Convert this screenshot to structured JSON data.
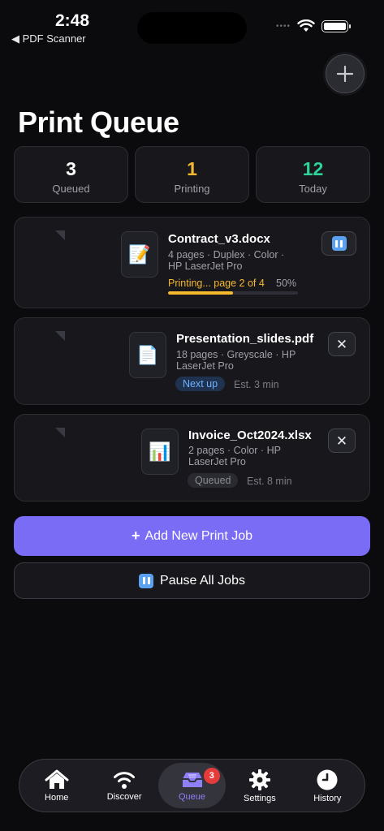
{
  "status_bar": {
    "time": "2:48",
    "back_label": "◀ PDF Scanner"
  },
  "header": {
    "title": "Print Queue"
  },
  "stats": [
    {
      "value": "3",
      "label": "Queued",
      "color": "#ffffff"
    },
    {
      "value": "1",
      "label": "Printing",
      "color": "#f5b92e"
    },
    {
      "value": "12",
      "label": "Today",
      "color": "#2ed39a"
    }
  ],
  "jobs": [
    {
      "name": "Contract_v3.docx",
      "meta_line1": "4 pages · Duplex · Color ·",
      "meta_line2": "HP LaserJet Pro",
      "icon": "📝",
      "status_text": "Printing... page 2 of 4",
      "progress_label": "50%",
      "progress": 0.5,
      "action": "pause"
    },
    {
      "name": "Presentation_slides.pdf",
      "meta_line1": "18 pages · Greyscale · HP",
      "meta_line2": "LaserJet Pro",
      "icon": "📄",
      "badge": "Next up",
      "estimate": "Est. 3 min",
      "action": "remove"
    },
    {
      "name": "Invoice_Oct2024.xlsx",
      "meta_line1": "2 pages · Color · HP",
      "meta_line2": "LaserJet Pro",
      "icon": "📊",
      "badge": "Queued",
      "estimate": "Est. 8 min",
      "action": "remove"
    }
  ],
  "buttons": {
    "add_job": "Add New Print Job",
    "add_job_icon": "+",
    "pause_all": "Pause All Jobs",
    "close_glyph": "✕"
  },
  "tabbar": {
    "items": [
      {
        "label": "Home",
        "icon": "home-icon"
      },
      {
        "label": "Discover",
        "icon": "wifi-icon"
      },
      {
        "label": "Queue",
        "icon": "inbox-tray-icon",
        "active": true,
        "badge": "3"
      },
      {
        "label": "Settings",
        "icon": "gear-icon"
      },
      {
        "label": "History",
        "icon": "clock-icon"
      }
    ]
  },
  "colors": {
    "accent": "#7b6cf6",
    "printing": "#f5b92e",
    "success": "#2ed39a",
    "info": "#6fb0ff",
    "danger": "#e53b3b"
  }
}
